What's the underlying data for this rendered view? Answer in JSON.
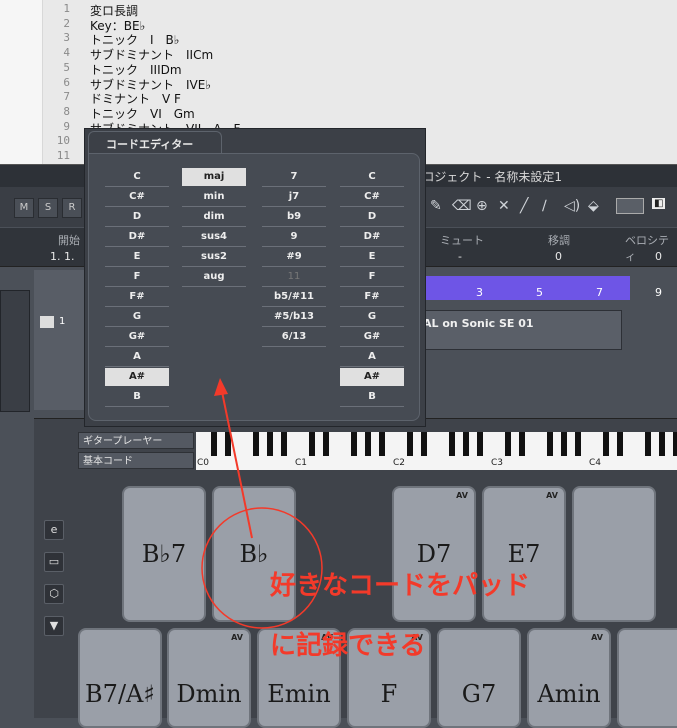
{
  "editor": {
    "lines": [
      {
        "n": "1",
        "text": "変ロ長調"
      },
      {
        "n": "2",
        "text": "Key：BE♭"
      },
      {
        "n": "3",
        "text": "トニック　I　B♭"
      },
      {
        "n": "4",
        "text": "サブドミナント　IICm"
      },
      {
        "n": "5",
        "text": "トニック　IIIDm"
      },
      {
        "n": "6",
        "text": "サブドミナント　IVE♭"
      },
      {
        "n": "7",
        "text": "ドミナント　V F"
      },
      {
        "n": "8",
        "text": "トニック　VI　Gm"
      },
      {
        "n": "9",
        "text": "サブドミナント　VII　A　F"
      },
      {
        "n": "10",
        "text": ""
      },
      {
        "n": "11",
        "text": ""
      }
    ]
  },
  "window": {
    "title": "プロジェクト - 名称未設定1",
    "buttons": [
      "M",
      "S",
      "R"
    ]
  },
  "info": {
    "labels": {
      "start": "開始",
      "mute": "ミュート",
      "transpose": "移調",
      "velocity": "ベロシティ"
    },
    "values": {
      "start": "1. 1.",
      "mute": "-",
      "transpose": "0",
      "velocity": "0"
    }
  },
  "ruler": {
    "marks": [
      "3",
      "5",
      "7",
      "9"
    ]
  },
  "track": {
    "number": "1",
    "event_label": "AL on Sonic SE 01"
  },
  "chord_editor": {
    "tab": "コードエディター",
    "roots": [
      "C",
      "C#",
      "D",
      "D#",
      "E",
      "F",
      "F#",
      "G",
      "G#",
      "A",
      "A#",
      "B"
    ],
    "types": [
      "maj",
      "min",
      "dim",
      "sus4",
      "sus2",
      "aug"
    ],
    "tensions": [
      "7",
      "j7",
      "b9",
      "9",
      "#9",
      "11",
      "b5/#11",
      "#5/b13",
      "6/13"
    ],
    "bass": [
      "C",
      "C#",
      "D",
      "D#",
      "E",
      "F",
      "F#",
      "G",
      "G#",
      "A",
      "A#",
      "B"
    ],
    "selected_root": "A#",
    "selected_type": "maj",
    "selected_bass": "A#",
    "disabled_tension": "11"
  },
  "chord_track": {
    "player": "ギタープレーヤー",
    "preset": "基本コード",
    "keyboard_labels": [
      "C0",
      "C1",
      "C2",
      "C3",
      "C4"
    ]
  },
  "pads": {
    "av": "AV",
    "top": [
      {
        "label": "B♭7",
        "av": false
      },
      {
        "label": "B♭",
        "av": false
      },
      {
        "label": "D7",
        "av": true
      },
      {
        "label": "E7",
        "av": true
      },
      {
        "label": "",
        "av": false
      }
    ],
    "bottom": [
      {
        "label": "B7/A♯",
        "av": false
      },
      {
        "label": "Dmin",
        "av": true
      },
      {
        "label": "Emin",
        "av": true
      },
      {
        "label": "F",
        "av": true
      },
      {
        "label": "G7",
        "av": false
      },
      {
        "label": "Amin",
        "av": true
      },
      {
        "label": "",
        "av": false
      }
    ]
  },
  "annotation": {
    "line1": "好きなコードをパッド",
    "line2": "に記録できる",
    "color": "#f33a2a"
  },
  "colors": {
    "ruler": "#6e55e6",
    "selected": "#e0e0e0"
  }
}
